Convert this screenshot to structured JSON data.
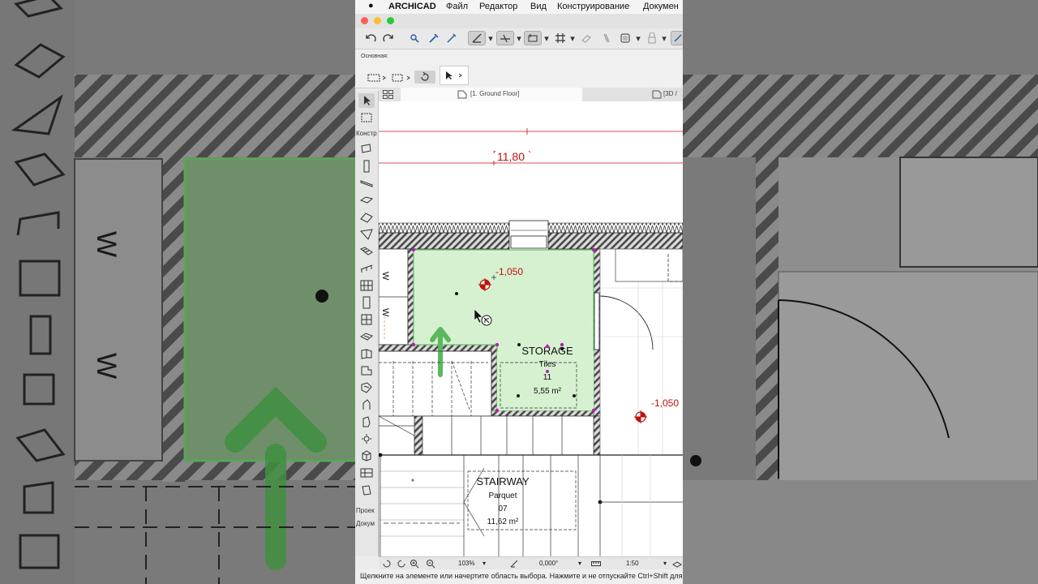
{
  "menubar": {
    "app_name": "ARCHICAD",
    "items": [
      "Файл",
      "Редактор",
      "Вид",
      "Конструирование",
      "Докумен"
    ]
  },
  "colors": {
    "zone_fill": "#d6f1d0",
    "zone_border": "#6fbf6f",
    "accent_red": "#d01010",
    "highlight_arrow": "#5cb85c",
    "wall_hatch": "#555555"
  },
  "infobox": {
    "label": "Основная:"
  },
  "toolbox": {
    "groups": [
      "Констр",
      "Проек",
      "Докум"
    ]
  },
  "tabs": {
    "floor_plan": "[1. Ground Floor]",
    "view_3d": "[3D /"
  },
  "plan": {
    "elevation_top": "11,80",
    "elevation_storage": "-1,050",
    "elevation_right": "-1,050",
    "storage": {
      "name": "STORAGE",
      "material": "Tiles",
      "number": "11",
      "area": "5,55 m²"
    },
    "stairway": {
      "name": "STAIRWAY",
      "material": "Parquet",
      "number": "07",
      "area": "11,62 m²"
    },
    "wardrobe_marks": [
      "W",
      "W"
    ]
  },
  "statusbar": {
    "zoom": "103%",
    "angle": "0,000°",
    "scale": "1:50"
  },
  "hint": "Щелкните на элементе или начертите область выбора. Нажмите и не отпускайте Ctrl+Shift для"
}
